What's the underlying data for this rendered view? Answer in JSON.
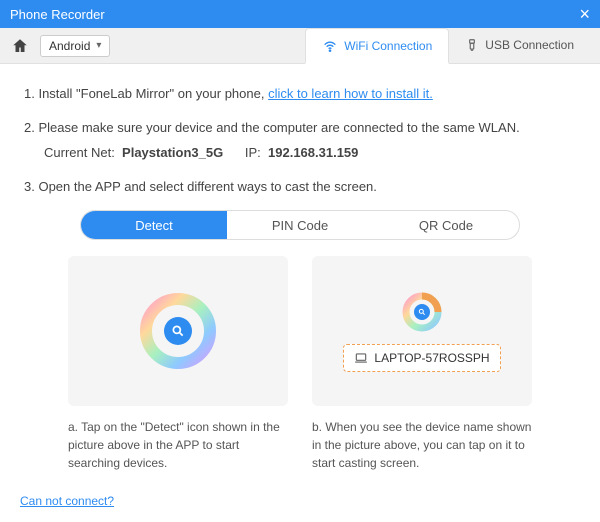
{
  "window": {
    "title": "Phone Recorder"
  },
  "toolbar": {
    "platform": "Android"
  },
  "connTabs": {
    "wifi": "WiFi Connection",
    "usb": "USB Connection"
  },
  "steps": {
    "s1_pre": "1. Install \"FoneLab Mirror\" on your phone, ",
    "s1_link": "click to learn how to install it.",
    "s2": "2. Please make sure your device and the computer are connected to the same WLAN.",
    "netLabel": "Current Net:",
    "netName": "Playstation3_5G",
    "ipLabel": "IP:",
    "ipValue": "192.168.31.159",
    "s3": "3. Open the APP and select different ways to cast the screen."
  },
  "methods": {
    "detect": "Detect",
    "pin": "PIN Code",
    "qr": "QR Code"
  },
  "panels": {
    "device": "LAPTOP-57ROSSPH",
    "a": "a. Tap on the \"Detect\" icon shown in the picture above in the APP to start searching devices.",
    "b": "b. When you see the device name shown in the picture above, you can tap on it to start casting screen."
  },
  "footer": {
    "help": "Can not connect?"
  }
}
